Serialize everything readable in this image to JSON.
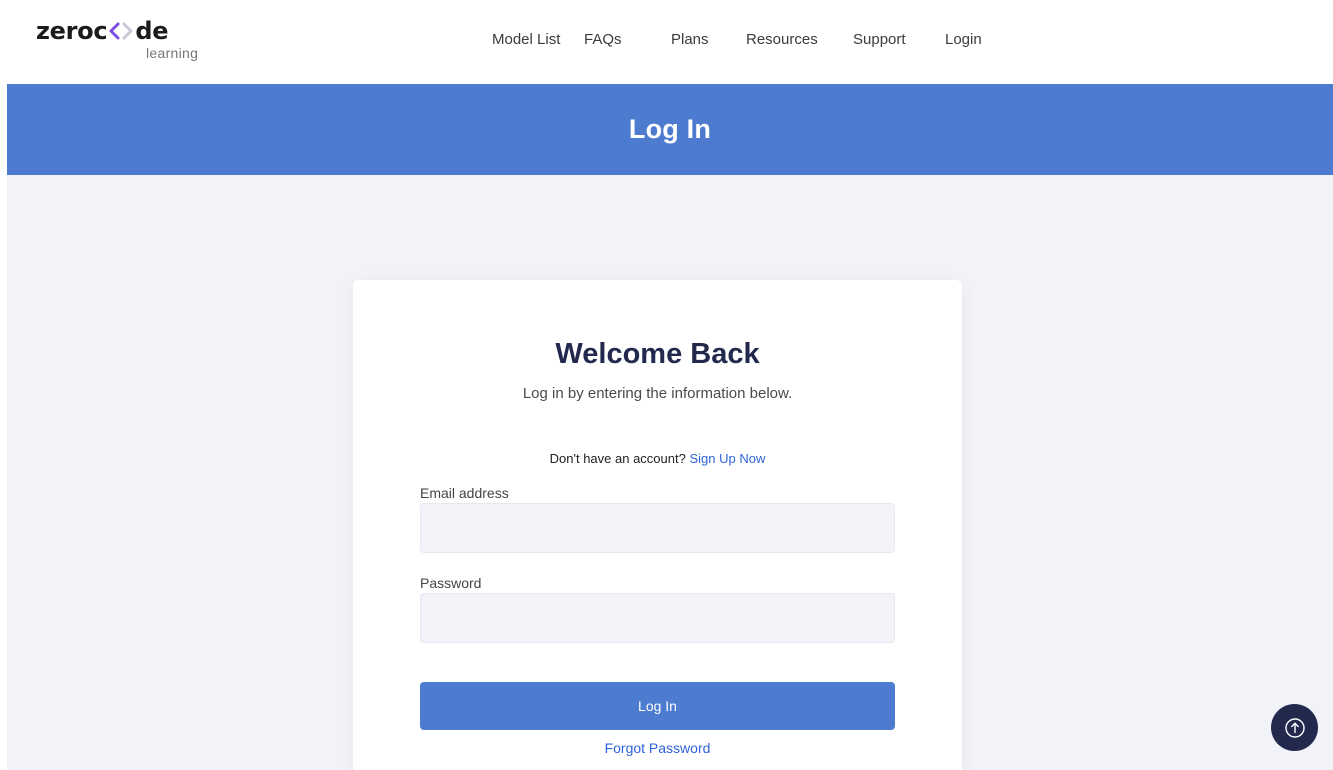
{
  "logo": {
    "text_before": "zeroc",
    "text_after": "de",
    "subtext": "learning"
  },
  "nav": {
    "items": [
      {
        "label": "Model List"
      },
      {
        "label": "FAQs"
      },
      {
        "label": "Plans"
      },
      {
        "label": "Resources"
      },
      {
        "label": "Support"
      },
      {
        "label": "Login"
      }
    ]
  },
  "banner": {
    "title": "Log In"
  },
  "card": {
    "title": "Welcome Back",
    "subtitle": "Log in by entering the information below.",
    "signup_prompt": "Don't have an account?",
    "signup_link": "Sign Up Now",
    "email": {
      "label": "Email address",
      "value": "",
      "placeholder": ""
    },
    "password": {
      "label": "Password",
      "value": "",
      "placeholder": ""
    },
    "login_button": "Log In",
    "forgot_link": "Forgot Password"
  },
  "scroll_top": {
    "icon": "arrow-up-circle-icon"
  },
  "colors": {
    "primary": "#4c7bd0",
    "heading": "#22294d",
    "link": "#2f63d8",
    "logo_accent": "#7b4fe0",
    "background": "#f2f3f8"
  }
}
